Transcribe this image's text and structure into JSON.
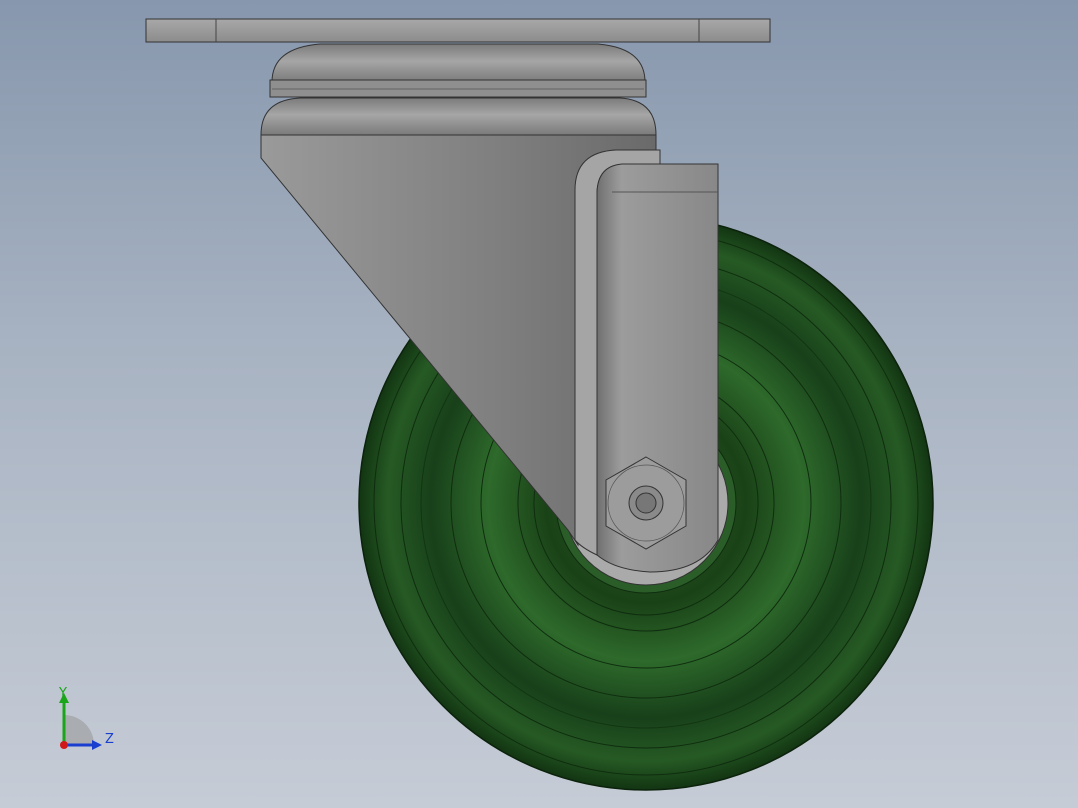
{
  "viewport": {
    "background_top": "#8797ad",
    "background_bottom": "#c6ccd6"
  },
  "model": {
    "part": "swivel-caster",
    "wheel_color": "#1e4a1e",
    "bracket_color": "#8a8a8a"
  },
  "triad": {
    "y_label": "Y",
    "z_label": "Z",
    "y_color": "#1aa51a",
    "z_color": "#1a3fd0",
    "x_color": "#d01a1a"
  }
}
